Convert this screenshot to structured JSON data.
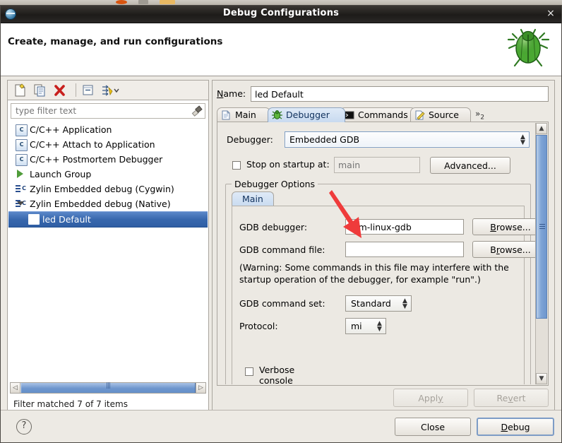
{
  "window": {
    "title": "Debug Configurations",
    "close_label": "×",
    "app_icon": "eclipse-icon"
  },
  "header": {
    "heading": "Create, manage, and run configurations",
    "decor_icon": "bug-icon"
  },
  "toolbar": {
    "buttons": [
      {
        "name": "new-launch-configuration-button",
        "icon": "new-file-icon"
      },
      {
        "name": "duplicate-launch-configuration-button",
        "icon": "copy-icon"
      },
      {
        "name": "delete-launch-configuration-button",
        "icon": "delete-x-icon"
      },
      {
        "name": "collapse-all-button",
        "icon": "collapse-all-icon"
      },
      {
        "name": "filter-launch-configurations-button",
        "icon": "filter-icon"
      }
    ]
  },
  "filter": {
    "placeholder": "type filter text",
    "value": "",
    "clear_icon": "clear-brush-icon"
  },
  "tree": {
    "items": [
      {
        "label": "C/C++ Application",
        "icon": "c-app-icon",
        "depth": 1,
        "selected": false,
        "expandable": false
      },
      {
        "label": "C/C++ Attach to Application",
        "icon": "c-app-icon",
        "depth": 1,
        "selected": false,
        "expandable": false
      },
      {
        "label": "C/C++ Postmortem Debugger",
        "icon": "c-app-icon",
        "depth": 1,
        "selected": false,
        "expandable": false
      },
      {
        "label": "Launch Group",
        "icon": "launch-group-icon",
        "depth": 1,
        "selected": false,
        "expandable": false
      },
      {
        "label": "Zylin Embedded debug (Cygwin)",
        "icon": "zylin-icon",
        "depth": 1,
        "selected": false,
        "expandable": false
      },
      {
        "label": "Zylin Embedded debug (Native)",
        "icon": "zylin-icon",
        "depth": 1,
        "selected": false,
        "expandable": true
      },
      {
        "label": "led Default",
        "icon": "zylin-icon",
        "depth": 2,
        "selected": true,
        "expandable": false
      }
    ]
  },
  "filter_status": "Filter matched 7 of 7 items",
  "name_field": {
    "label": "Name:",
    "label_mnemonic": "N",
    "value": "led Default"
  },
  "tabs": [
    {
      "label": "Main",
      "icon": "document-icon",
      "active": false
    },
    {
      "label": "Debugger",
      "icon": "bug-small-icon",
      "active": true
    },
    {
      "label": "Commands",
      "icon": "terminal-icon",
      "active": false
    },
    {
      "label": "Source",
      "icon": "source-icon",
      "active": false
    }
  ],
  "tabs_overflow": {
    "chevron": "»",
    "count": "2"
  },
  "debugger_panel": {
    "debugger_label": "Debugger:",
    "debugger_value": "Embedded GDB",
    "stop_on_startup": {
      "label": "Stop on startup at:",
      "checked": false,
      "placeholder": "main",
      "value": ""
    },
    "advanced_button": "Advanced...",
    "group_title": "Debugger Options",
    "inner_tab": "Main",
    "gdb_debugger": {
      "label": "GDB debugger:",
      "value": "arm-linux-gdb",
      "browse": "Browse...",
      "browse_mnemonic": "B"
    },
    "gdb_command_file": {
      "label": "GDB command file:",
      "value": "",
      "browse": "Browse...",
      "browse_mnemonic": "r"
    },
    "warning_text": "(Warning: Some commands in this file may interfere with the startup operation of the debugger, for example \"run\".)",
    "gdb_command_set": {
      "label": "GDB command set:",
      "value": "Standard"
    },
    "protocol": {
      "label": "Protocol:",
      "value": "mi"
    },
    "verbose_console": {
      "label": "Verbose console mode",
      "checked": false
    }
  },
  "action_buttons": {
    "apply": "Apply",
    "apply_mnemonic": "y",
    "revert": "Revert",
    "revert_mnemonic": "v"
  },
  "footer": {
    "help_icon": "help-question-icon",
    "close": "Close",
    "debug": "Debug",
    "debug_mnemonic": "D"
  },
  "annotation": {
    "arrow_color": "#ef3b3b",
    "points_to": "gdb-debugger-input"
  }
}
